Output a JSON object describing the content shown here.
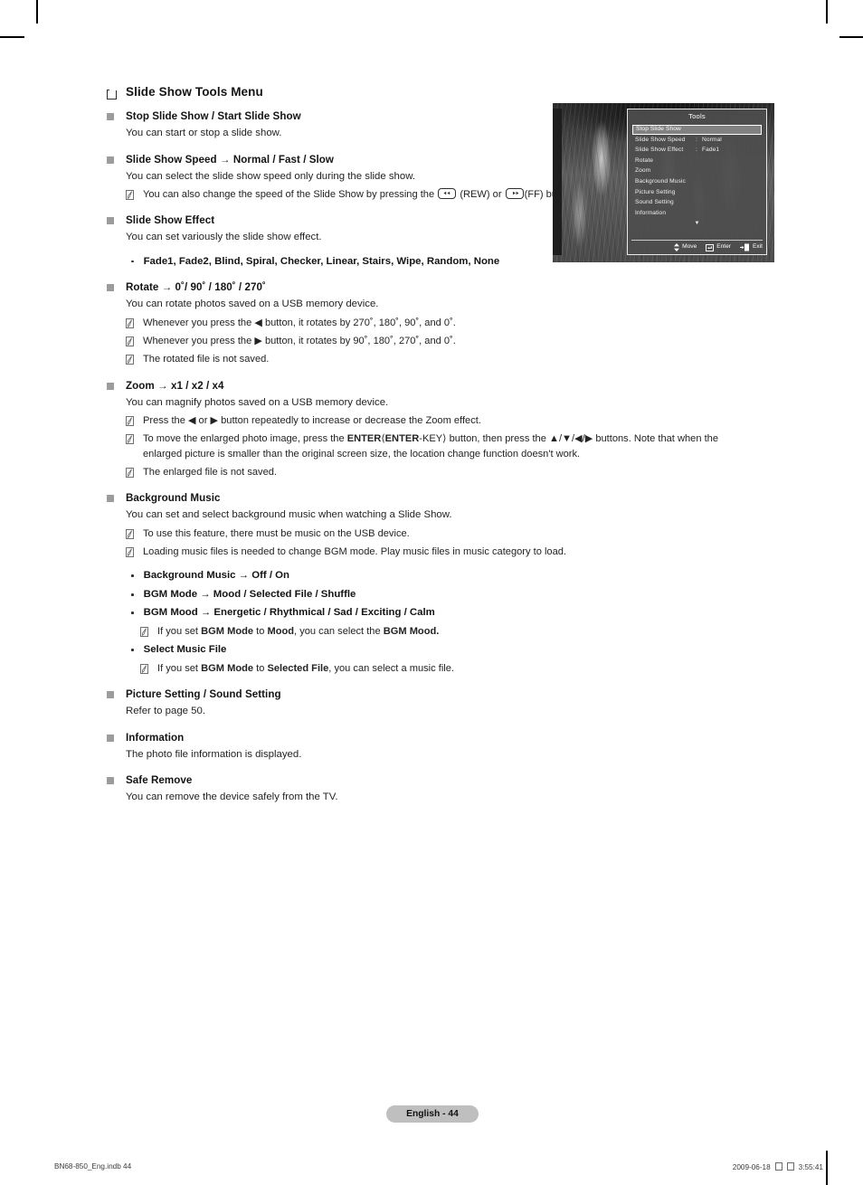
{
  "section": {
    "title": "Slide Show Tools Menu"
  },
  "items": [
    {
      "head": "Stop Slide Show / Start Slide Show",
      "desc": "You can start or stop a slide show.",
      "notes": [],
      "opts": []
    },
    {
      "head": "Slide Show Speed → Normal / Fast / Slow",
      "desc": "You can select the slide show speed only during the slide show.",
      "notes": [
        "You can also change the speed of the Slide Show by pressing the ⟨REW-KEY⟩ (REW) or ⟨FF-KEY⟩(FF) button during the Slide Show."
      ],
      "opts": []
    },
    {
      "head": "Slide Show Effect",
      "desc": "You can set variously the slide show effect.",
      "notes": [],
      "opts": [
        "Fade1, Fade2, Blind, Spiral, Checker, Linear, Stairs, Wipe, Random, None"
      ]
    },
    {
      "head": "Rotate → 0˚/ 90˚ / 180˚ / 270˚",
      "desc": "You can rotate photos saved on a USB memory device.",
      "notes": [
        "Whenever you press the ◀ button, it rotates by 270˚, 180˚, 90˚, and 0˚.",
        "Whenever you press the ▶ button, it rotates by 90˚, 180˚, 270˚, and 0˚.",
        "The rotated file is not saved."
      ],
      "opts": []
    },
    {
      "head": "Zoom → x1 / x2 / x4",
      "desc": "You can magnify photos saved on a USB memory device.",
      "notes": [
        "Press the ◀ or ▶ button repeatedly to increase or decrease the Zoom effect.",
        "To move the enlarged photo image, press the ENTER⟨ENTER-KEY⟩ button, then press the ▲/▼/◀/▶ buttons. Note that when the enlarged picture is smaller than the original screen size, the location change function doesn't work.",
        "The enlarged file is not saved."
      ],
      "opts": []
    },
    {
      "head": "Background Music",
      "desc": "You can set and select background music when watching a Slide Show.",
      "notes": [
        "To use this feature, there must be music on the USB device.",
        "Loading music files is needed to change BGM mode. Play music files in music category to load."
      ],
      "opts": [
        "Background Music → Off / On",
        "BGM Mode → Mood / Selected File / Shuffle",
        "BGM Mood → Energetic / Rhythmical / Sad / Exciting / Calm",
        "Select Music File"
      ],
      "opt_notes": {
        "2": "If you set BGM Mode to Mood, you can select the BGM Mood.",
        "3": "If you set BGM Mode to Selected File, you can select a music file."
      }
    },
    {
      "head": "Picture Setting / Sound Setting",
      "desc": "Refer to page 50.",
      "notes": [],
      "opts": []
    },
    {
      "head": "Information",
      "desc": "The photo file information is displayed.",
      "notes": [],
      "opts": []
    },
    {
      "head": "Safe Remove",
      "desc": "You can remove the device safely from the TV.",
      "notes": [],
      "opts": []
    }
  ],
  "tv_menu": {
    "title": "Tools",
    "rows": [
      {
        "label": "Stop Slide Show",
        "colon": "",
        "value": "",
        "selected": true
      },
      {
        "label": "Slide Show Speed",
        "colon": ":",
        "value": "Normal",
        "selected": false
      },
      {
        "label": "Slide Show Effect",
        "colon": ":",
        "value": "Fade1",
        "selected": false
      },
      {
        "label": "Rotate",
        "colon": "",
        "value": "",
        "selected": false
      },
      {
        "label": "Zoom",
        "colon": "",
        "value": "",
        "selected": false
      },
      {
        "label": "Background Music",
        "colon": "",
        "value": "",
        "selected": false
      },
      {
        "label": "Picture Setting",
        "colon": "",
        "value": "",
        "selected": false
      },
      {
        "label": "Sound Setting",
        "colon": "",
        "value": "",
        "selected": false
      },
      {
        "label": "Information",
        "colon": "",
        "value": "",
        "selected": false
      }
    ],
    "more_indicator": "▼",
    "footer": {
      "move": "Move",
      "enter": "Enter",
      "exit": "Exit"
    }
  },
  "footer": {
    "page_label": "English - 44",
    "print_left": "BN68-850_Eng.indb   44",
    "print_date": "2009-06-18",
    "print_time": "3:55:41"
  }
}
